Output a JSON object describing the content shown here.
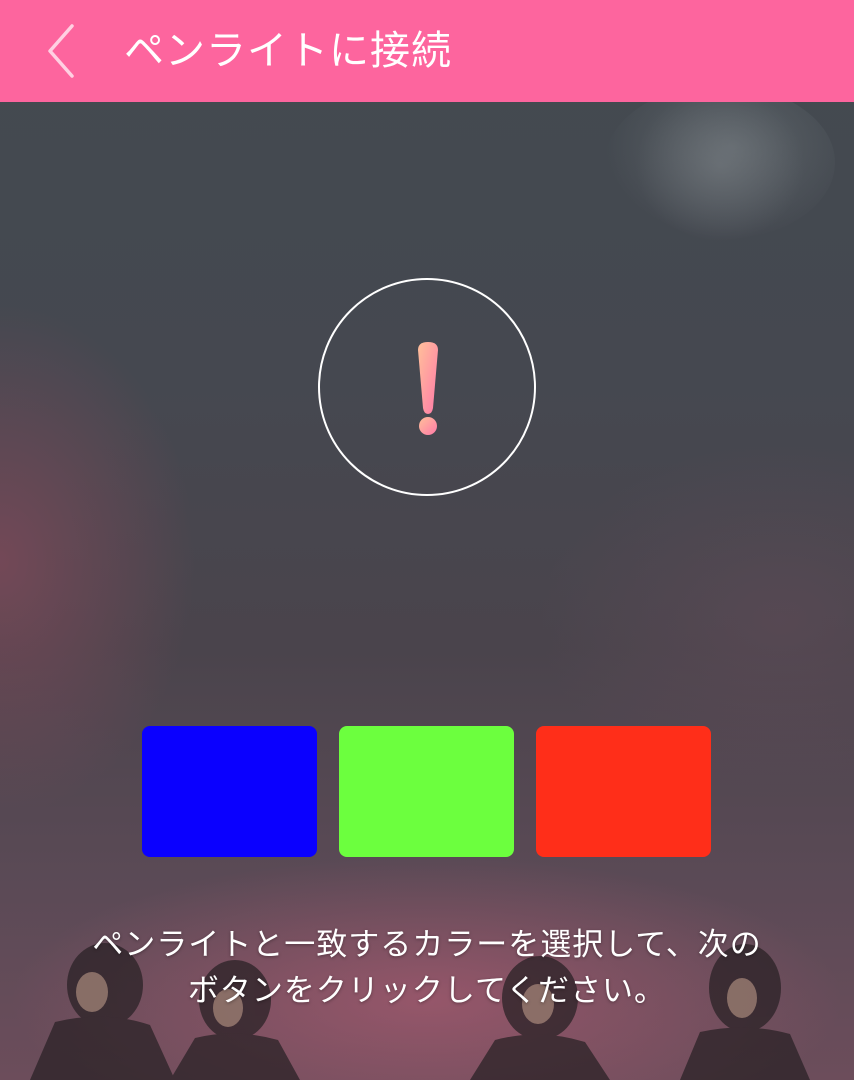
{
  "header": {
    "title": "ペンライトに接続",
    "back_icon": "chevron-left-icon",
    "background_color": "#fd659e"
  },
  "alert": {
    "icon": "exclamation-icon"
  },
  "swatches": [
    {
      "name": "blue",
      "color": "#0a00ff"
    },
    {
      "name": "green",
      "color": "#6cff3e"
    },
    {
      "name": "red",
      "color": "#ff2e19"
    }
  ],
  "instruction": {
    "line1": "ペンライトと一致するカラーを選択して、次の",
    "line2": "ボタンをクリックしてください。"
  }
}
